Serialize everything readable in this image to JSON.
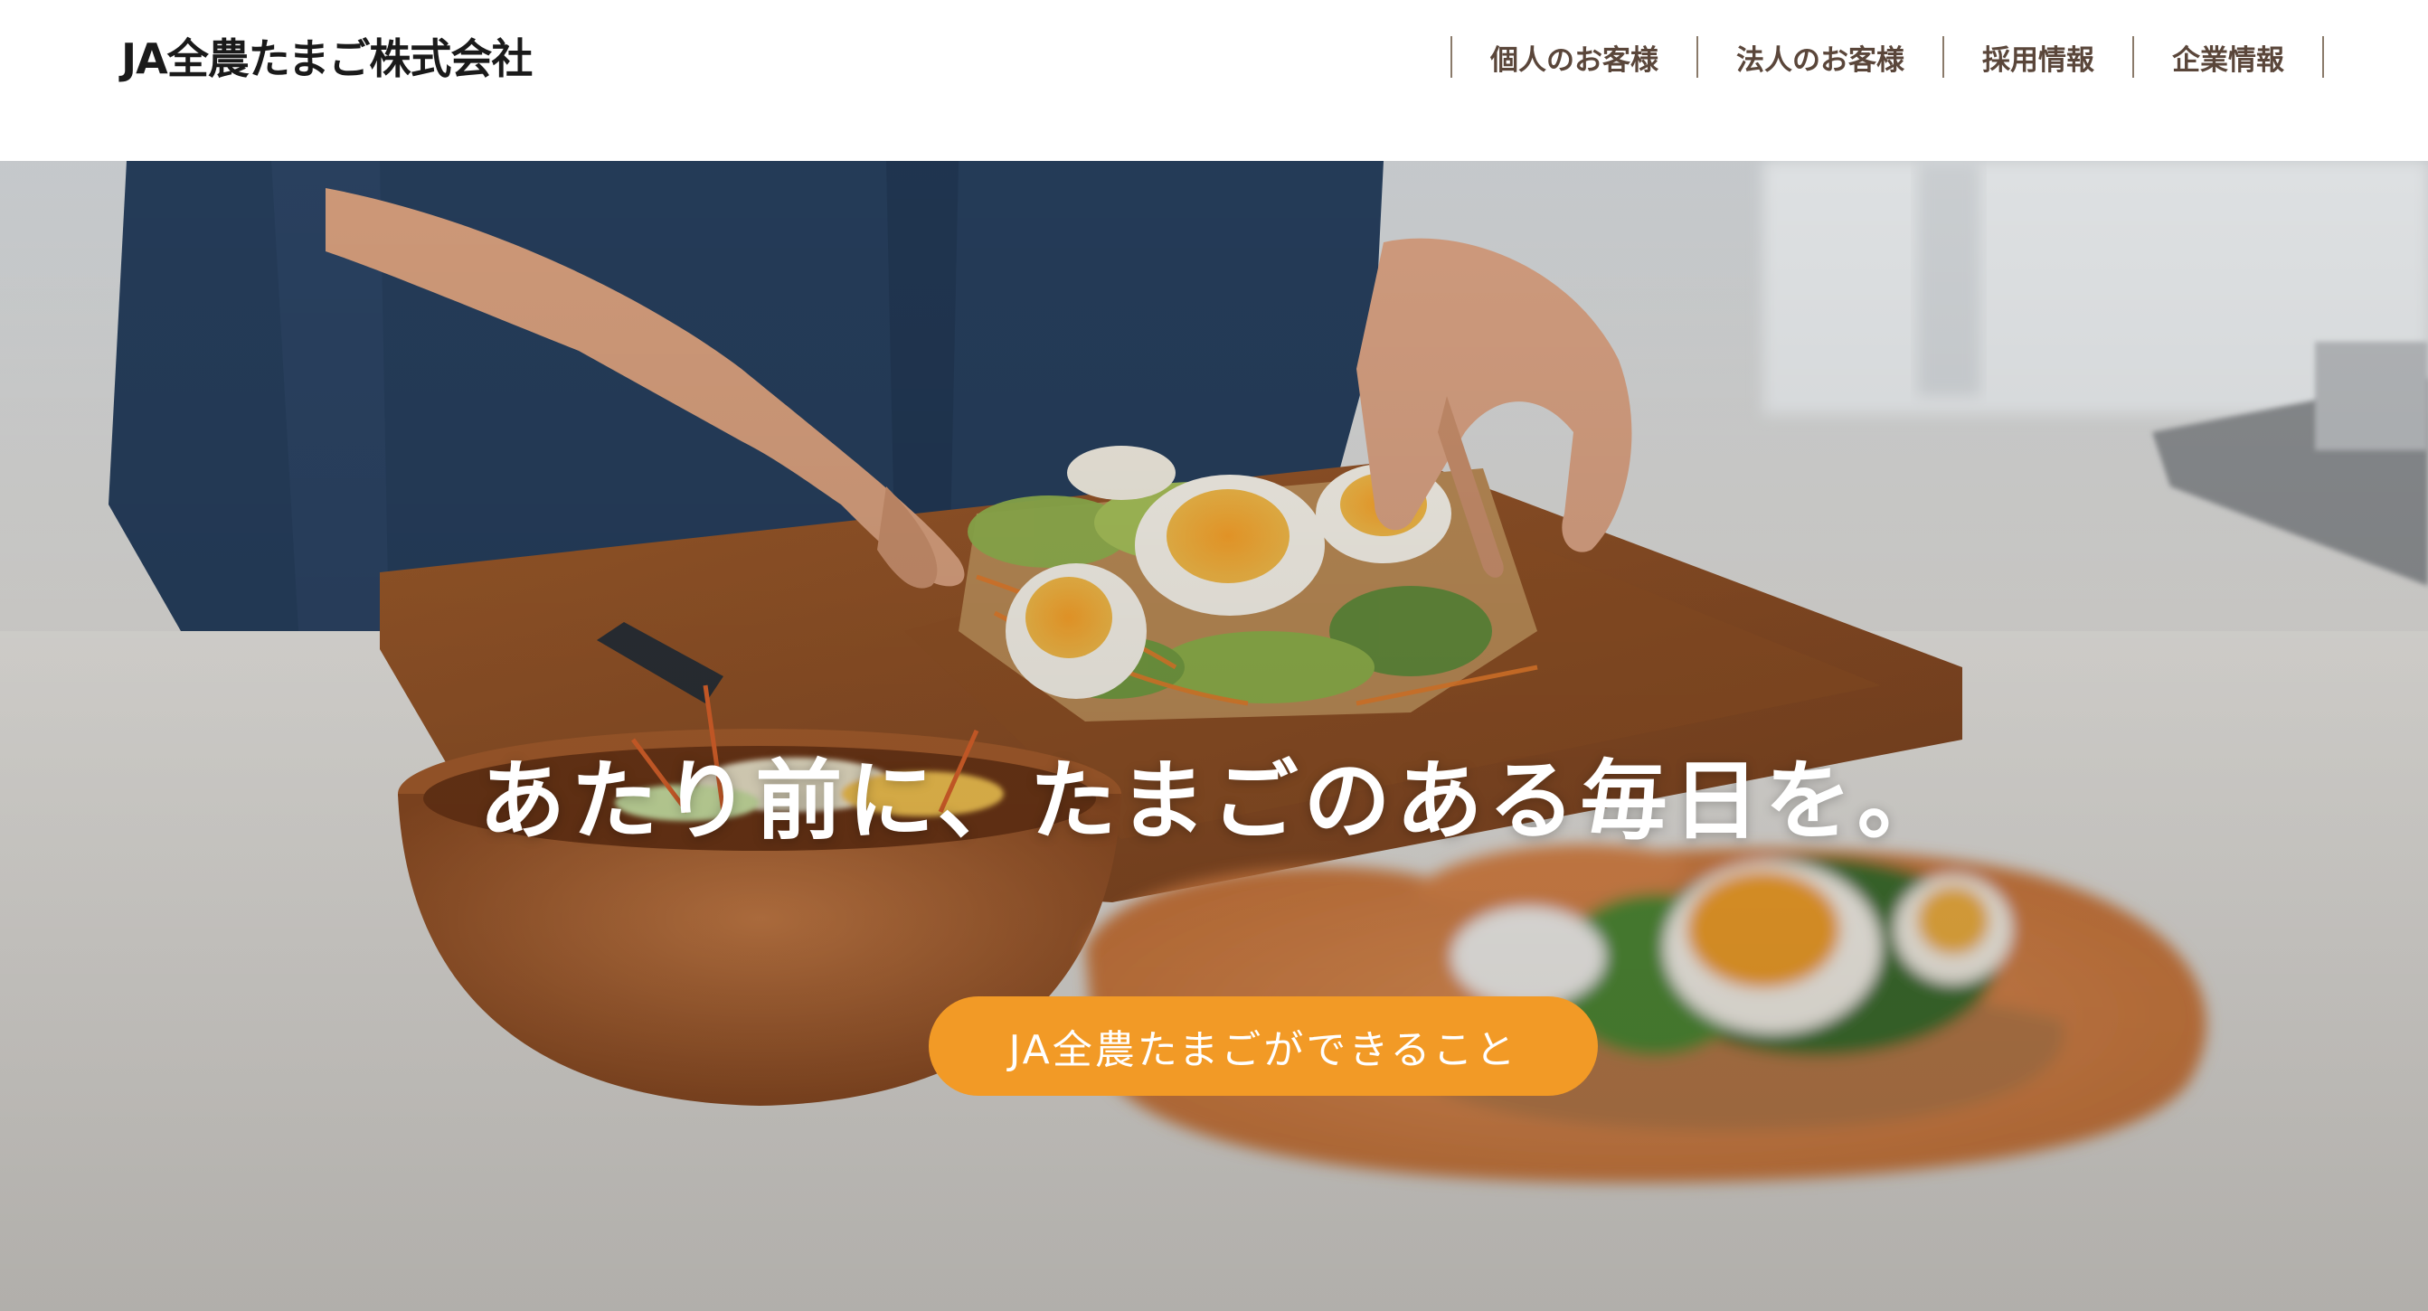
{
  "header": {
    "logo_text": "JA全農たまご株式会社",
    "nav": [
      {
        "label": "個人のお客様"
      },
      {
        "label": "法人のお客様"
      },
      {
        "label": "採用情報"
      },
      {
        "label": "企業情報"
      }
    ]
  },
  "hero": {
    "headline": "あたり前に、たまごのある毎日を。",
    "cta_label": "JA全農たまごができること"
  },
  "colors": {
    "accent": "#f29a26",
    "nav_text": "#5a463a",
    "logo_text": "#1a1a1a"
  }
}
